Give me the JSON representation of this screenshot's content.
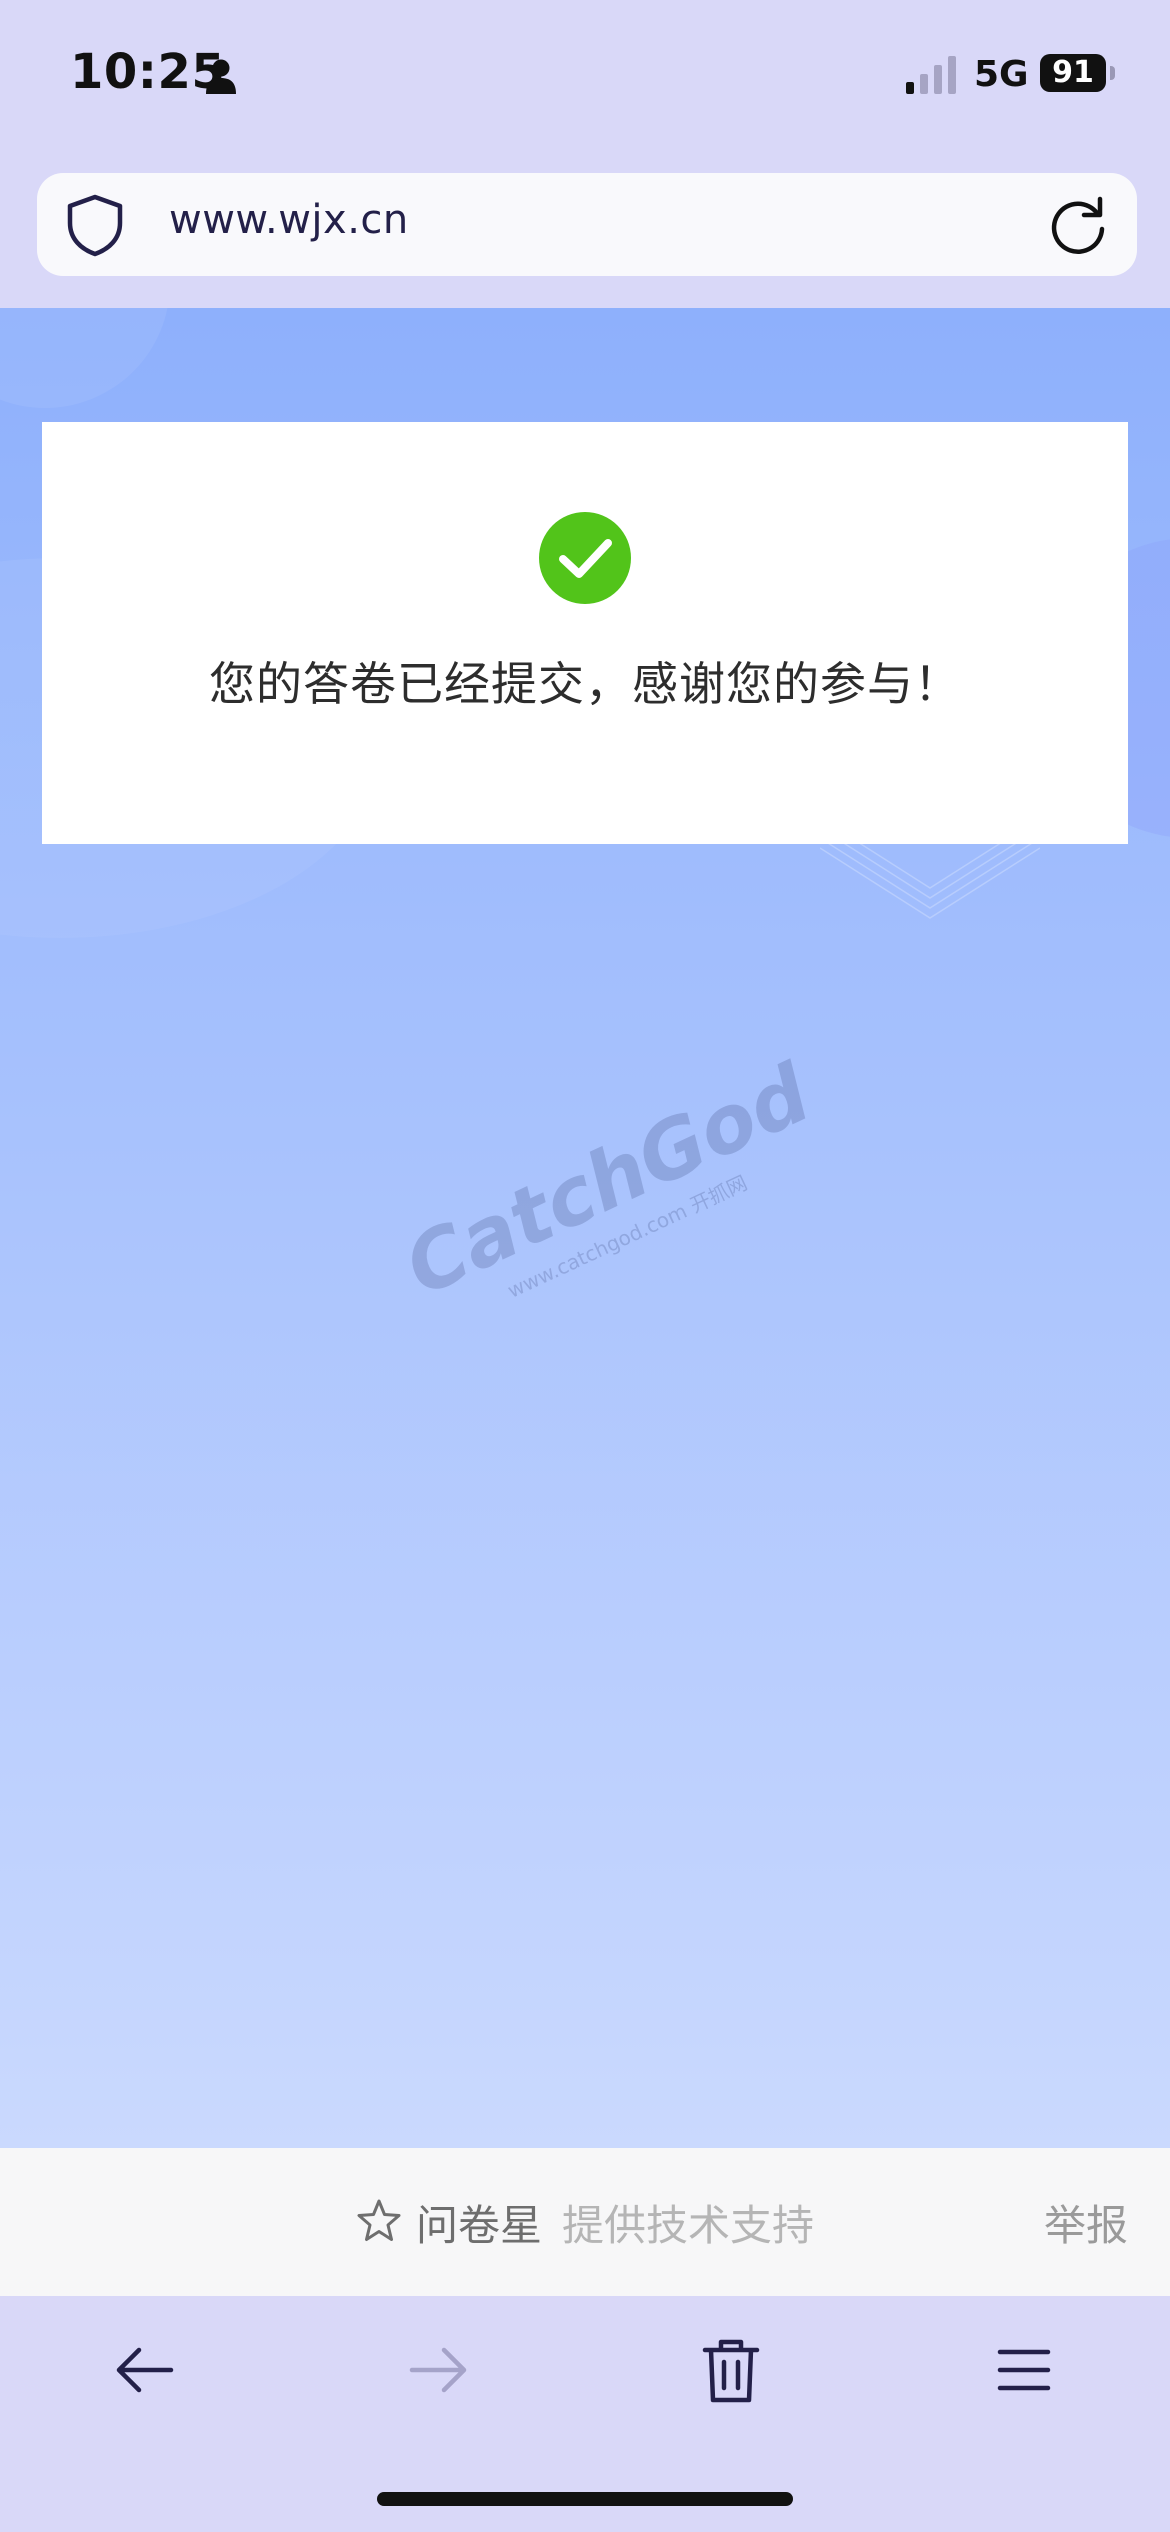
{
  "status_bar": {
    "time": "10:25",
    "network": "5G",
    "battery": "91",
    "icons": [
      "person-icon",
      "signal-icon",
      "battery-icon"
    ]
  },
  "address_bar": {
    "url": "www.wjx.cn",
    "icons": [
      "shield-icon",
      "reload-icon"
    ]
  },
  "result": {
    "message": "您的答卷已经提交，感谢您的参与！",
    "icon": "check-circle-icon",
    "icon_color": "#52c41a"
  },
  "watermark": {
    "logo": "CatchGod",
    "sub": "www.catchgod.com 开抓网"
  },
  "footer": {
    "brand": "问卷星",
    "support_text": "提供技术支持",
    "report": "举报",
    "icon": "star-icon"
  },
  "toolbar": {
    "icons": [
      "back-arrow-icon",
      "forward-arrow-icon",
      "trash-icon",
      "menu-icon"
    ]
  },
  "colors": {
    "chrome": "#d9d8f8",
    "page_top": "#8eb0fc",
    "page_bottom": "#cad9fe",
    "accent": "#232049"
  }
}
